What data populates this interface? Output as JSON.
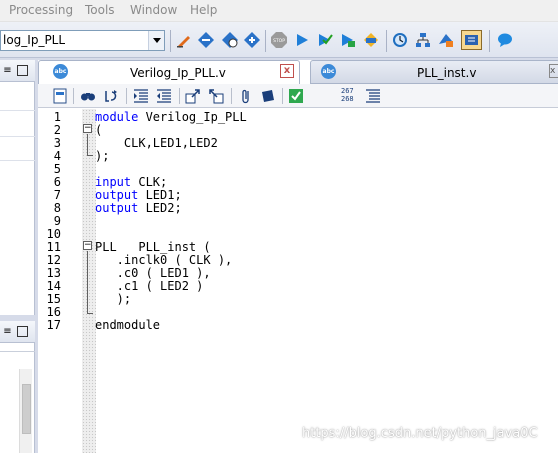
{
  "menu": {
    "items": [
      "Processing",
      "Tools",
      "Window",
      "Help"
    ]
  },
  "toolbar": {
    "entity_value": "log_Ip_PLL",
    "icons": [
      "edit-icon",
      "compile-icon",
      "analysis-icon",
      "synthesis-icon",
      "stop-icon",
      "start-icon",
      "fitter-icon",
      "assembler-icon",
      "timing-icon",
      "clock-icon",
      "hierarchy-icon",
      "chip-planner-icon",
      "programmer-icon",
      "help-chat-icon"
    ]
  },
  "tabs": [
    {
      "label": "Verilog_Ip_PLL.v",
      "icon": "abc-icon",
      "active": true,
      "close": "x"
    },
    {
      "label": "PLL_inst.v",
      "icon": "abc-icon",
      "active": false,
      "close": "x"
    }
  ],
  "editor_toolbar": {
    "line_numbers_icon": [
      "267",
      "268"
    ]
  },
  "code": {
    "line_numbers": [
      "1",
      "2",
      "3",
      "4",
      "5",
      "6",
      "7",
      "8",
      "9",
      "10",
      "11",
      "12",
      "13",
      "14",
      "15",
      "16",
      "17"
    ],
    "lines": [
      [
        {
          "t": "module",
          "k": true
        },
        {
          "t": " Verilog_Ip_PLL"
        }
      ],
      [
        {
          "t": "("
        }
      ],
      [
        {
          "t": "    CLK,LED1,LED2"
        }
      ],
      [
        {
          "t": ");"
        }
      ],
      [
        {
          "t": ""
        }
      ],
      [
        {
          "t": "input",
          "k": true
        },
        {
          "t": " CLK;"
        }
      ],
      [
        {
          "t": "output",
          "k": true
        },
        {
          "t": " LED1;"
        }
      ],
      [
        {
          "t": "output",
          "k": true
        },
        {
          "t": " LED2;"
        }
      ],
      [
        {
          "t": ""
        }
      ],
      [
        {
          "t": ""
        }
      ],
      [
        {
          "t": "PLL   PLL_inst ("
        }
      ],
      [
        {
          "t": "   .inclk0 ( CLK ),"
        }
      ],
      [
        {
          "t": "   .c0 ( LED1 ),"
        }
      ],
      [
        {
          "t": "   .c1 ( LED2 )"
        }
      ],
      [
        {
          "t": "   );"
        }
      ],
      [
        {
          "t": ""
        }
      ],
      [
        {
          "t": "endmodule"
        }
      ]
    ]
  },
  "watermark": "https://blog.csdn.net/python_java0C"
}
